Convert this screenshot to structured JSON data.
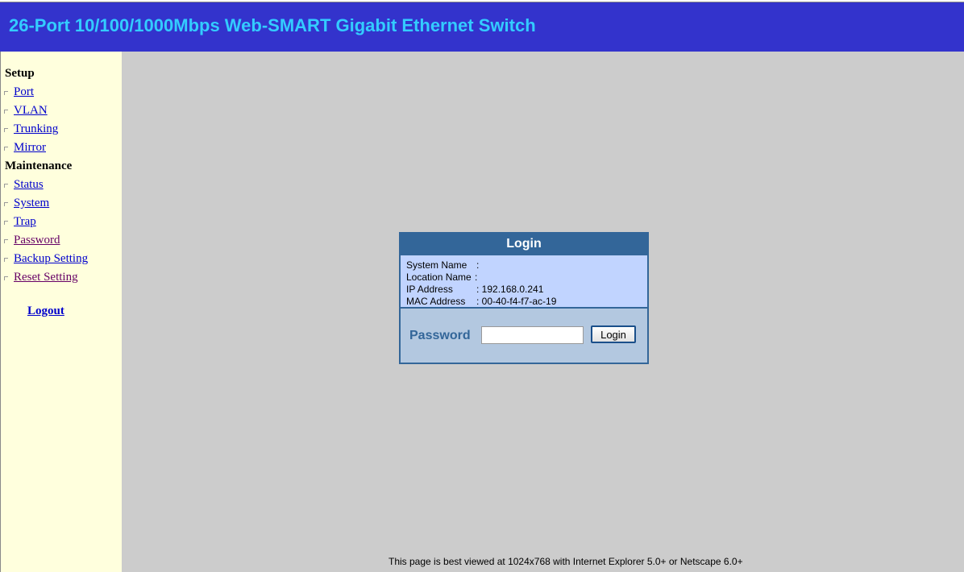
{
  "header": {
    "title": "26-Port 10/100/1000Mbps Web-SMART Gigabit Ethernet Switch"
  },
  "sidebar": {
    "setup_heading": "Setup",
    "setup_items": [
      {
        "label": "Port"
      },
      {
        "label": "VLAN"
      },
      {
        "label": "Trunking"
      },
      {
        "label": "Mirror"
      }
    ],
    "maintenance_heading": "Maintenance",
    "maintenance_items": [
      {
        "label": "Status"
      },
      {
        "label": "System"
      },
      {
        "label": "Trap"
      },
      {
        "label": "Password"
      },
      {
        "label": "Backup Setting"
      },
      {
        "label": "Reset Setting"
      }
    ],
    "logout_label": "Logout"
  },
  "login": {
    "title": "Login",
    "info": {
      "system_name_label": "System Name",
      "system_name_value": ":",
      "location_name_label": "Location Name",
      "location_name_value": ":",
      "ip_address_label": "IP Address",
      "ip_address_value": ": 192.168.0.241",
      "mac_address_label": "MAC Address",
      "mac_address_value": ": 00-40-f4-f7-ac-19"
    },
    "password_label": "Password",
    "password_value": "",
    "button_label": "Login"
  },
  "footer": {
    "note": "This page is best viewed at 1024x768 with Internet Explorer 5.0+ or Netscape 6.0+"
  },
  "colors": {
    "header_bg": "#3333cc",
    "header_text": "#33ccff",
    "sidebar_bg": "#ffffdd",
    "content_bg": "#cccccc",
    "panel_border": "#336699",
    "info_bg": "#c1d4ff",
    "link": "#0000cc",
    "visited_link": "#660066"
  }
}
